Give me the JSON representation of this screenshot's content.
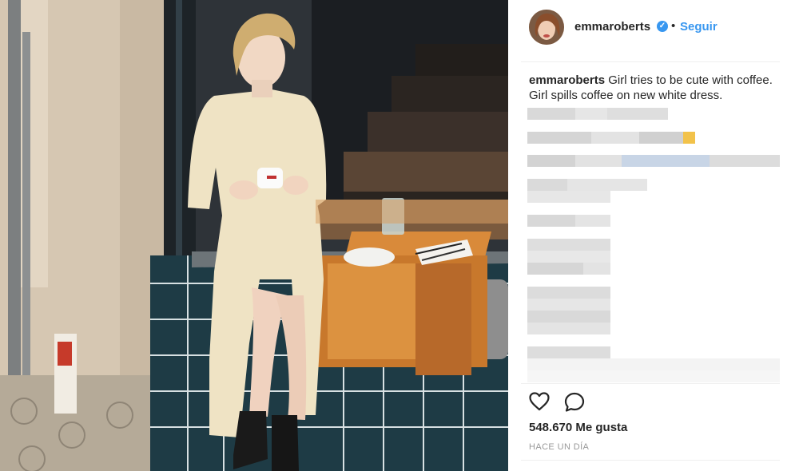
{
  "post": {
    "author": "emmaroberts",
    "verified_icon": "verified-badge-icon",
    "separator": "•",
    "follow_label": "Seguir",
    "caption_user": "emmaroberts",
    "caption_text": " Girl tries to be cute with coffee. Girl spills coffee on new white dress.",
    "likes": "548.670 Me gusta",
    "time_ago": "HACE UN DÍA"
  },
  "icons": {
    "like": "heart-icon",
    "comment": "comment-bubble-icon"
  },
  "colors": {
    "accent": "#3897f0",
    "text": "#262626",
    "muted": "#999999",
    "divider": "#efefef"
  }
}
